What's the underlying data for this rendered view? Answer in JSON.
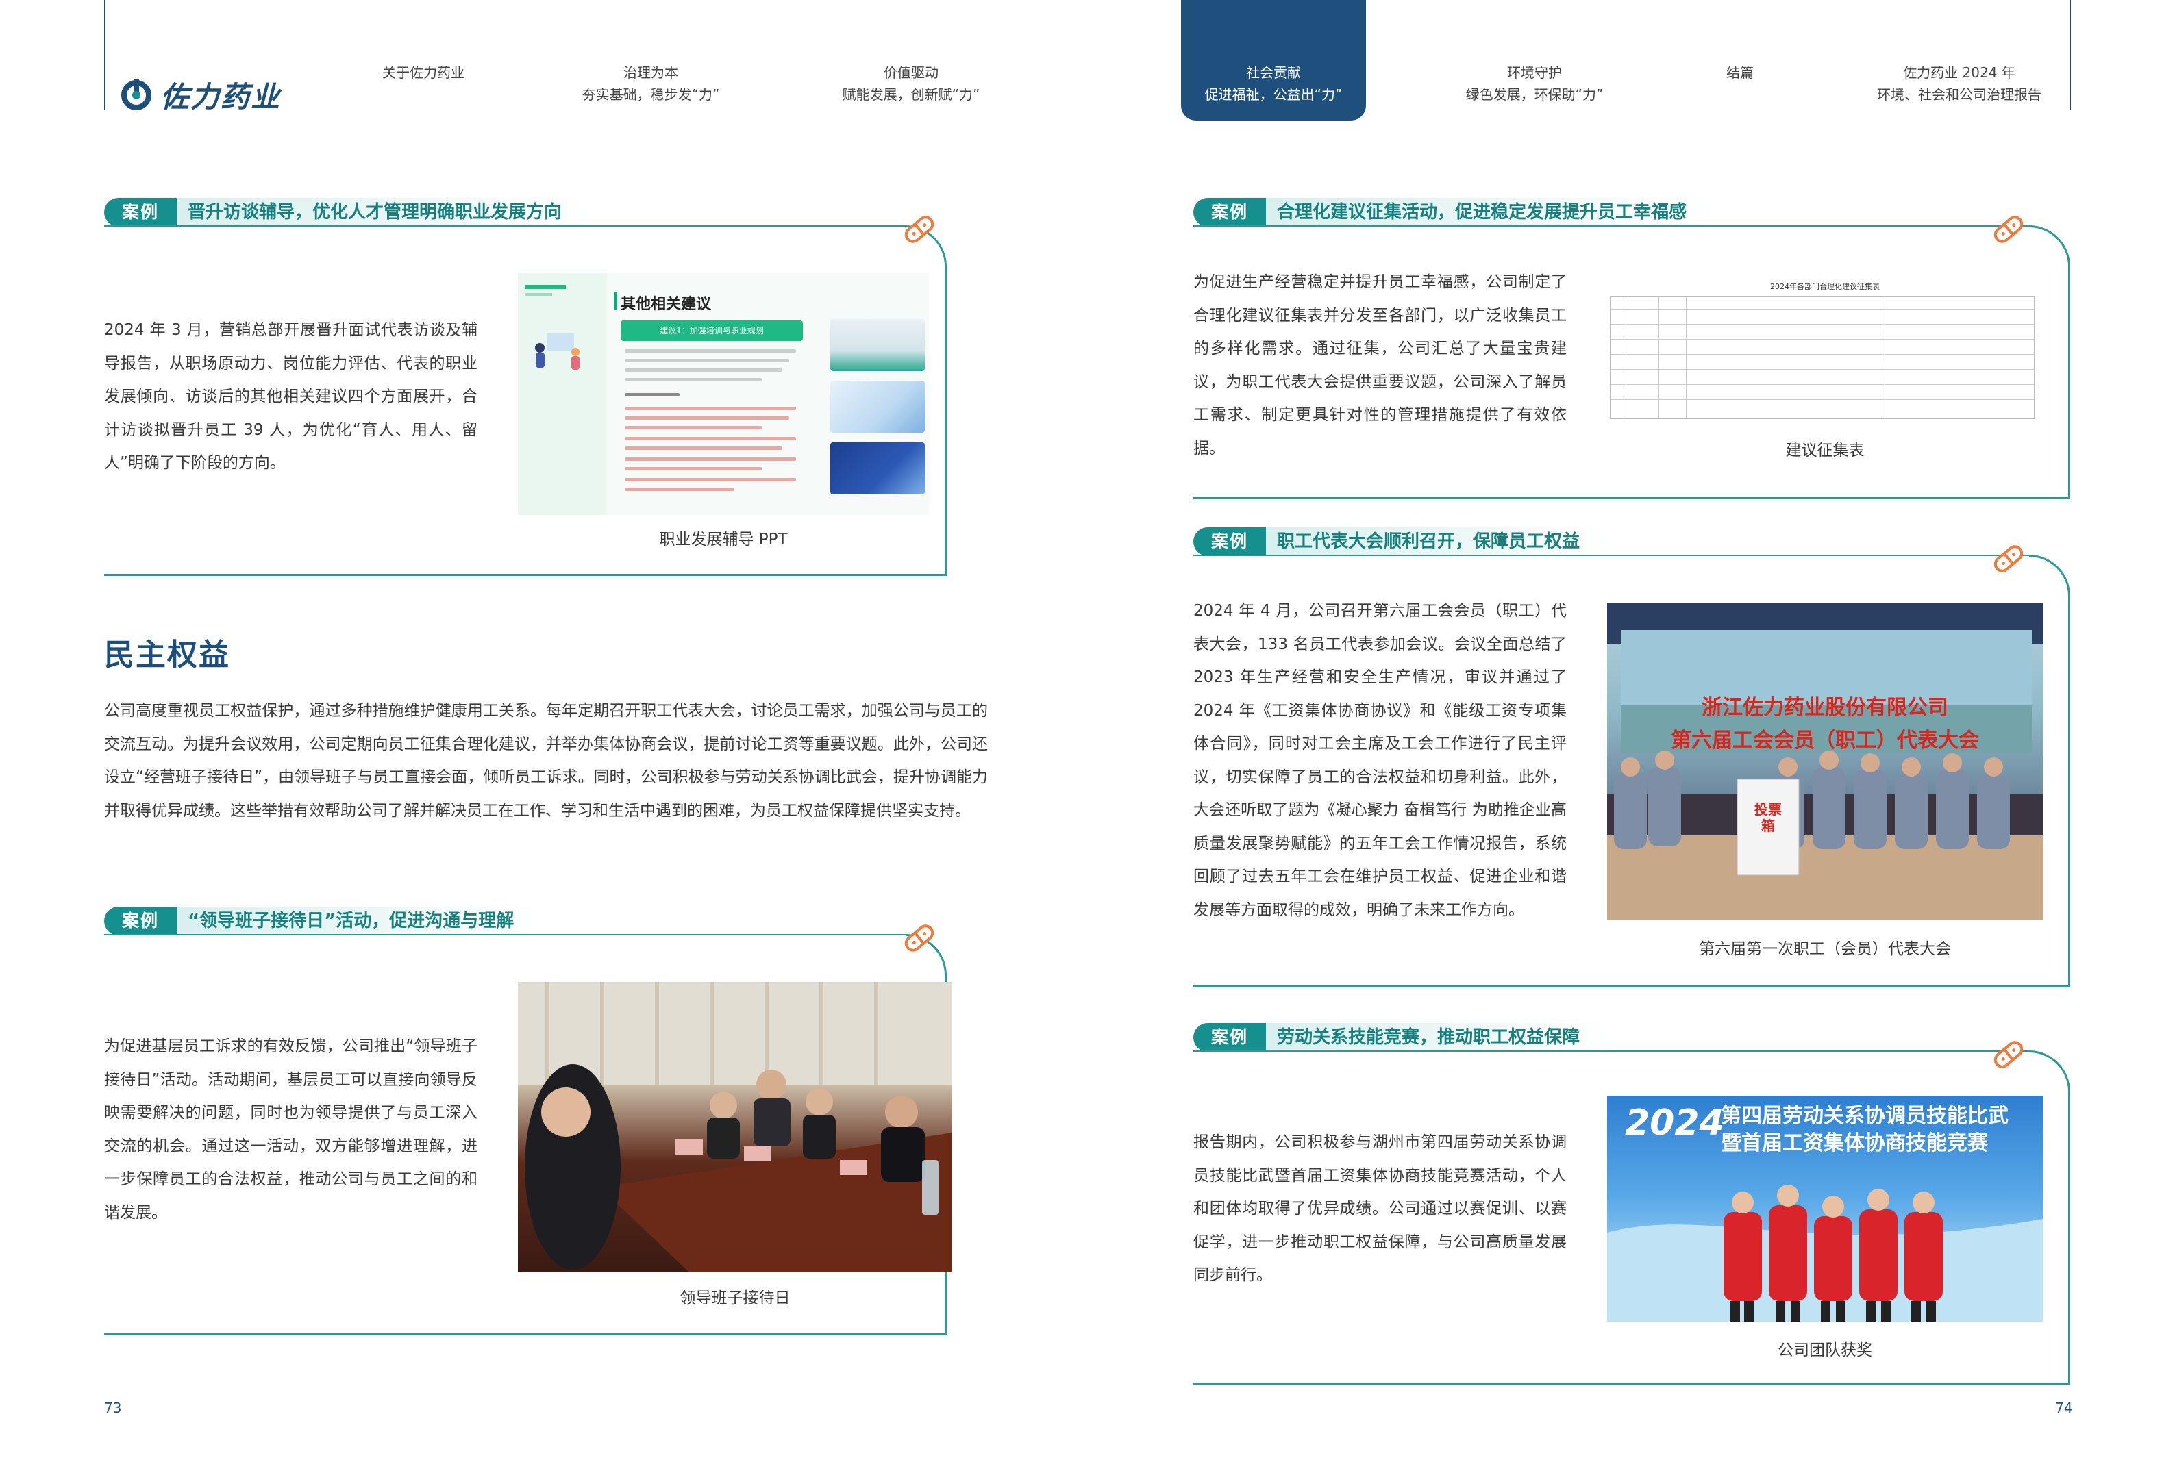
{
  "header": {
    "logo_text": "佐力药业",
    "nav": [
      {
        "l1": "",
        "l2": "关于佐力药业"
      },
      {
        "l1": "治理为本",
        "l2": "夯实基础，稳步发“力”"
      },
      {
        "l1": "价值驱动",
        "l2": "赋能发展，创新赋“力”"
      },
      {
        "l1": "社会贡献",
        "l2": "促进福祉，公益出“力”"
      },
      {
        "l1": "环境守护",
        "l2": "绿色发展，环保助“力”"
      },
      {
        "l1": "",
        "l2": "结篇"
      },
      {
        "l1": "佐力药业 2024 年",
        "l2": "环境、社会和公司治理报告"
      }
    ]
  },
  "left": {
    "case1": {
      "badge": "案例",
      "title": "晋升访谈辅导，优化人才管理明确职业发展方向",
      "text": "2024 年 3 月，营销总部开展晋升面试代表访谈及辅导报告，从职场原动力、岗位能力评估、代表的职业发展倾向、访谈后的其他相关建议四个方面展开，合计访谈拟晋升员工 39 人，为优化“育人、用人、留人”明确了下阶段的方向。",
      "caption": "职业发展辅导 PPT",
      "ppt_title": "其他相关建议",
      "ppt_banner": "建议1：加强培训与职业规划"
    },
    "section_title": "民主权益",
    "section_text": "公司高度重视员工权益保护，通过多种措施维护健康用工关系。每年定期召开职工代表大会，讨论员工需求，加强公司与员工的交流互动。为提升会议效用，公司定期向员工征集合理化建议，并举办集体协商会议，提前讨论工资等重要议题。此外，公司还设立“经营班子接待日”，由领导班子与员工直接会面，倾听员工诉求。同时，公司积极参与劳动关系协调比武会，提升协调能力并取得优异成绩。这些举措有效帮助公司了解并解决员工在工作、学习和生活中遇到的困难，为员工权益保障提供坚实支持。",
    "case2": {
      "badge": "案例",
      "title": "“领导班子接待日”活动，促进沟通与理解",
      "text": "为促进基层员工诉求的有效反馈，公司推出“领导班子接待日”活动。活动期间，基层员工可以直接向领导反映需要解决的问题，同时也为领导提供了与员工深入交流的机会。通过这一活动，双方能够增进理解，进一步保障员工的合法权益，推动公司与员工之间的和谐发展。",
      "caption": "领导班子接待日"
    },
    "page_number": "73"
  },
  "right": {
    "case1": {
      "badge": "案例",
      "title": "合理化建议征集活动，促进稳定发展提升员工幸福感",
      "text": "为促进生产经营稳定并提升员工幸福感，公司制定了合理化建议征集表并分发至各部门，以广泛收集员工的多样化需求。通过征集，公司汇总了大量宝贵建议，为职工代表大会提供重要议题，公司深入了解员工需求、制定更具针对性的管理措施提供了有效依据。",
      "caption": "建议征集表",
      "form_title": "2024年各部门合理化建议征集表"
    },
    "case2": {
      "badge": "案例",
      "title": "职工代表大会顺利召开，保障员工权益",
      "text": "2024 年 4 月，公司召开第六届工会会员（职工）代表大会，133 名员工代表参加会议。会议全面总结了 2023 年生产经营和安全生产情况，审议并通过了 2024 年《工资集体协商协议》和《能级工资专项集体合同》，同时对工会主席及工会工作进行了民主评议，切实保障了员工的合法权益和切身利益。此外，大会还听取了题为《凝心聚力 奋楫笃行 为助推企业高质量发展聚势赋能》的五年工会工作情况报告，系统回顾了过去五年工会在维护员工权益、促进企业和谐发展等方面取得的成效，明确了未来工作方向。",
      "caption": "第六届第一次职工（会员）代表大会",
      "banner_line1": "浙江佐力药业股份有限公司",
      "banner_line2": "第六届工会会员（职工）代表大会",
      "box_label": "投票箱"
    },
    "case3": {
      "badge": "案例",
      "title": "劳动关系技能竞赛，推动职工权益保障",
      "text": "报告期内，公司积极参与湖州市第四届劳动关系协调员技能比武暨首届工资集体协商技能竞赛活动，个人和团体均取得了优异成绩。公司通过以赛促训、以赛促学，进一步推动职工权益保障，与公司高质量发展同步前行。",
      "caption": "公司团队获奖",
      "banner_year": "2024",
      "banner_line1": "第四届劳动关系协调员技能比武",
      "banner_line2": "暨首届工资集体协商技能竞赛"
    },
    "page_number": "74"
  },
  "colors": {
    "navy": "#1d4f7c",
    "teal": "#15908e"
  },
  "icons": [
    "logo-icon",
    "pill-icon"
  ]
}
